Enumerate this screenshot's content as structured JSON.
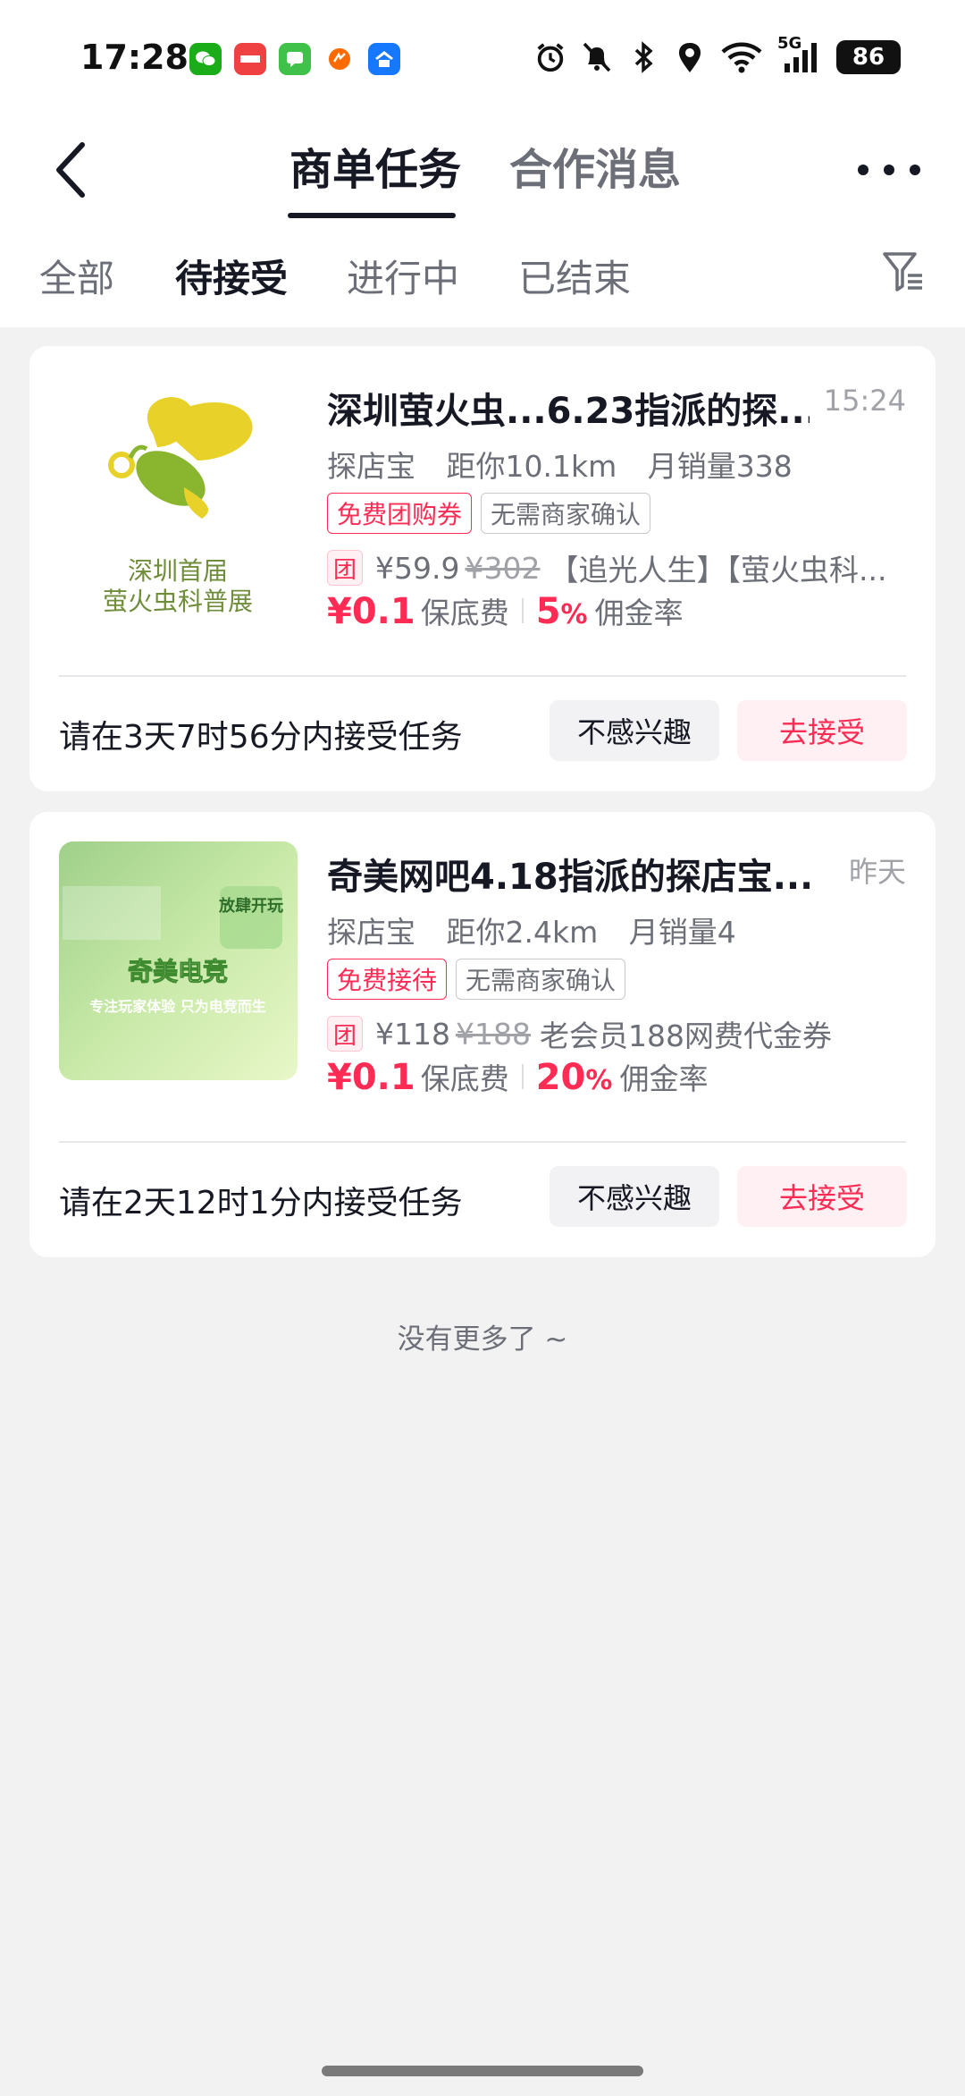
{
  "status_bar": {
    "time": "17:28",
    "network": "5G",
    "battery": "86"
  },
  "header": {
    "tabs": [
      {
        "label": "商单任务",
        "active": true
      },
      {
        "label": "合作消息",
        "active": false
      }
    ]
  },
  "filters": {
    "tabs": [
      {
        "label": "全部",
        "active": false
      },
      {
        "label": "待接受",
        "active": true
      },
      {
        "label": "进行中",
        "active": false
      },
      {
        "label": "已结束",
        "active": false
      }
    ]
  },
  "tasks": [
    {
      "title": "深圳萤火虫...6.23指派的探...",
      "time": "15:24",
      "thumb_text_1": "深圳首届",
      "thumb_text_2": "萤火虫科普展",
      "meta_type": "探店宝",
      "meta_distance": "距你10.1km",
      "meta_sales": "月销量338",
      "badge_red": "免费团购券",
      "badge_gray": "无需商家确认",
      "tuan": "团",
      "price_now": "¥59.9",
      "price_old": "¥302",
      "product": "【追光人生】【萤火虫科...",
      "fee": "¥0.1",
      "fee_label": "保底费",
      "rate": "5",
      "rate_pct": "%",
      "rate_label": "佣金率",
      "deadline": "请在3天7时56分内接受任务",
      "ignore_label": "不感兴趣",
      "accept_label": "去接受"
    },
    {
      "title": "奇美网吧4.18指派的探店宝...",
      "time": "昨天",
      "thumb_text_1": "放肆开玩",
      "thumb_text_2": "奇美电竞",
      "thumb_text_3": "专注玩家体验 只为电竞而生",
      "meta_type": "探店宝",
      "meta_distance": "距你2.4km",
      "meta_sales": "月销量4",
      "badge_red": "免费接待",
      "badge_gray": "无需商家确认",
      "tuan": "团",
      "price_now": "¥118",
      "price_old": "¥188",
      "product": "老会员188网费代金券",
      "fee": "¥0.1",
      "fee_label": "保底费",
      "rate": "20",
      "rate_pct": "%",
      "rate_label": "佣金率",
      "deadline": "请在2天12时1分内接受任务",
      "ignore_label": "不感兴趣",
      "accept_label": "去接受"
    }
  ],
  "end_text": "没有更多了 ~",
  "colors": {
    "accent": "#fe2c55",
    "text": "#161823",
    "muted": "#6d6f78",
    "background": "#f2f2f2"
  }
}
